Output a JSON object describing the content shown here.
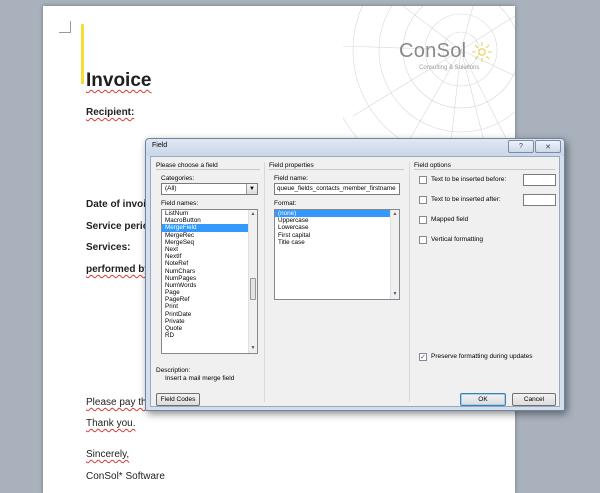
{
  "document": {
    "logo": {
      "name": "ConSol",
      "tagline": "Consulting & Solutions"
    },
    "title": "Invoice",
    "recipient": "Recipient:",
    "date_of_invoice": "Date of invoice",
    "service_period": "Service period",
    "services": "Services:",
    "performed_by": "performed by:",
    "please_pay": "Please pay the",
    "thank_you": "Thank you.",
    "sincerely": "Sincerely,",
    "signature": "ConSol* Software"
  },
  "dialog": {
    "title": "Field",
    "help_label": "?",
    "close_label": "✕",
    "choose_group": "Please choose a field",
    "categories_label": "Categories:",
    "categories_value": "(All)",
    "field_names_label": "Field names:",
    "field_names": [
      "ListNum",
      "MacroButton",
      "MergeField",
      "MergeRec",
      "MergeSeq",
      "Next",
      "NextIf",
      "NoteRef",
      "NumChars",
      "NumPages",
      "NumWords",
      "Page",
      "PageRef",
      "Print",
      "PrintDate",
      "Private",
      "Quote",
      "RD"
    ],
    "selected_field": "MergeField",
    "properties_group": "Field properties",
    "field_name_label": "Field name:",
    "field_name_value": "queue_fields_contacts_member_firstname",
    "format_label": "Format:",
    "formats": [
      "(none)",
      "Uppercase",
      "Lowercase",
      "First capital",
      "Title case"
    ],
    "selected_format": "(none)",
    "options_group": "Field options",
    "text_before_label": "Text to be inserted before:",
    "text_before_value": "",
    "text_after_label": "Text to be inserted after:",
    "text_after_value": "",
    "mapped_label": "Mapped field",
    "vertical_label": "Vertical formatting",
    "preserve_label": "Preserve formatting during updates",
    "preserve_checked": true,
    "description_label": "Description:",
    "description_text": "Insert a mail merge field",
    "field_codes_button": "Field Codes",
    "ok_button": "OK",
    "cancel_button": "Cancel"
  },
  "colors": {
    "selection": "#3399ff",
    "accent_bar": "#f4dd34",
    "dialog_frame": "#d4dfee",
    "spelling_underline": "#d73a3a"
  }
}
